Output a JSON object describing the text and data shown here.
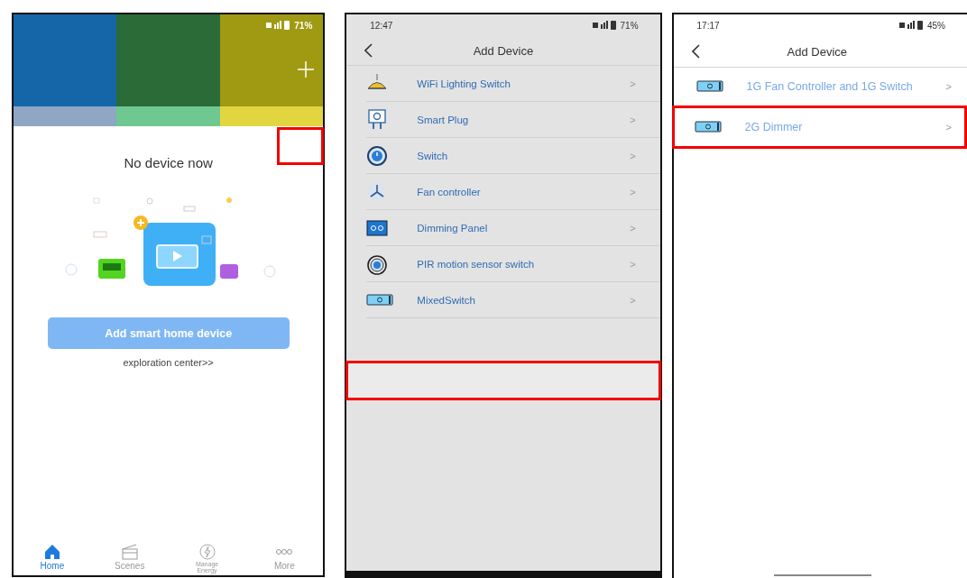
{
  "screens": [
    {
      "kind": "home",
      "status_bar": {
        "battery": "71%"
      },
      "highlight_box": true,
      "empty_title": "No device now",
      "add_button": "Add smart home device",
      "link": "exploration center>>",
      "nav": [
        {
          "kind": "home",
          "label": "Home",
          "selected": true
        },
        {
          "kind": "scenes",
          "label": "Scenes",
          "selected": false
        },
        {
          "kind": "energy",
          "label": "Manage Energy",
          "selected": false
        },
        {
          "kind": "more",
          "label": "More",
          "selected": false
        }
      ]
    },
    {
      "kind": "device_list",
      "status_bar": {
        "time": "12:47",
        "battery": "71%"
      },
      "title": "Add Device",
      "highlight_box": true,
      "items": [
        {
          "kind": "lamp",
          "label": "WiFi Lighting Switch",
          "chevron": ">",
          "highlighted": false
        },
        {
          "kind": "plug",
          "label": "Smart Plug",
          "chevron": ">",
          "highlighted": false
        },
        {
          "kind": "power",
          "label": "Switch",
          "chevron": ">",
          "highlighted": false
        },
        {
          "kind": "fan",
          "label": "Fan controller",
          "chevron": ">",
          "highlighted": false
        },
        {
          "kind": "panel",
          "label": "Dimming Panel",
          "chevron": ">",
          "highlighted": false
        },
        {
          "kind": "pir",
          "label": "PIR motion sensor switch",
          "chevron": ">",
          "highlighted": false
        },
        {
          "kind": "switch_panel",
          "label": "MixedSwitch",
          "chevron": ">",
          "highlighted": false
        }
      ]
    },
    {
      "kind": "device_list",
      "status_bar": {
        "time": "17:17",
        "battery": "45%"
      },
      "title": "Add Device",
      "items": [
        {
          "kind": "switch_panel",
          "label": "1G Fan Controller and 1G Switch",
          "chevron": ">",
          "highlighted": false
        },
        {
          "kind": "switch_panel",
          "label": "2G Dimmer",
          "chevron": ">",
          "highlighted": true
        }
      ]
    }
  ]
}
